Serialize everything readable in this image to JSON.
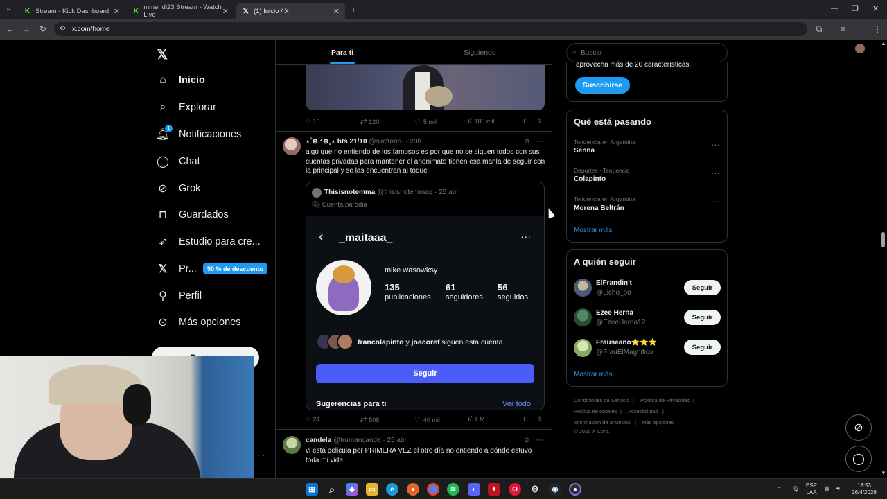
{
  "browser": {
    "tabs": [
      {
        "label": "Stream - Kick Dashboard",
        "favicon": "kick-icon"
      },
      {
        "label": "mmendi23 Stream - Watch Live",
        "favicon": "kick-icon"
      },
      {
        "label": "(1) Inicio / X",
        "favicon": "x-icon",
        "active": true
      }
    ],
    "url": "x.com/home"
  },
  "nav": {
    "logo": "X",
    "items": [
      {
        "label": "Inicio",
        "icon": "home-icon"
      },
      {
        "label": "Explorar",
        "icon": "search-icon"
      },
      {
        "label": "Notificaciones",
        "icon": "bell-icon",
        "badge": "1"
      },
      {
        "label": "Chat",
        "icon": "chat-icon"
      },
      {
        "label": "Grok",
        "icon": "grok-icon"
      },
      {
        "label": "Guardados",
        "icon": "bookmark-icon"
      },
      {
        "label": "Estudio para cre...",
        "icon": "rocket-icon"
      },
      {
        "label": "Pr...",
        "icon": "x-premium-icon"
      },
      {
        "label": "Perfil",
        "icon": "person-icon"
      },
      {
        "label": "Más opciones",
        "icon": "more-circle-icon"
      }
    ],
    "premium_badge": "50 % de descuento",
    "post_button": "Postear",
    "more_dots": "···"
  },
  "feed": {
    "tabs": {
      "for_you": "Para ti",
      "following": "Siguiendo"
    },
    "post1_actions": {
      "replies": "16",
      "reposts": "120",
      "likes": "5 mil",
      "views": "185 mil"
    },
    "post2": {
      "name": "⋆˚⊛.ᐟ⊛˳⋆ bts 21/10",
      "handle": "@swlftooru · 20h",
      "text": "algo que no entiendo de los famosos es por que no se siguen todos con sus cuentas privadas para mantener el anonimato tienen esa manla de seguir con la principal y se las encuentran al toque",
      "quote": {
        "name": "Thisisnotemma",
        "handle": "@thisisnotemmag · 25 abr.",
        "label": "Cuenta parodia",
        "profile": {
          "username": "_maitaaa_",
          "display_name": "mike wasowksy",
          "stats": [
            {
              "value": "135",
              "label": "publicaciones"
            },
            {
              "value": "61",
              "label": "seguidores"
            },
            {
              "value": "56",
              "label": "seguidos"
            }
          ],
          "followed_by_a": "francolapinto",
          "followed_by_y": "y",
          "followed_by_b": "joacoref",
          "followed_by_suffix": "siguen esta cuenta",
          "follow_button": "Seguir",
          "suggestions": "Sugerencias para ti",
          "see_all": "Ver todo"
        }
      },
      "actions": {
        "replies": "24",
        "reposts": "508",
        "likes": "40 mil",
        "views": "1 M"
      }
    },
    "post3": {
      "name": "candela",
      "handle": "@trumancande · 25 abr.",
      "text": "vi esta pelicula por PRIMERA VEZ el otro día no entiendo a dónde estuvo toda mi vida"
    }
  },
  "sidebar": {
    "search_placeholder": "Buscar",
    "premium_text": "aprovecha más de 20 características.",
    "subscribe": "Suscribirse",
    "trends_title": "Qué está pasando",
    "trends": [
      {
        "meta": "Tendencia en Argentina",
        "name": "Senna"
      },
      {
        "meta": "Deportes · Tendencia",
        "name": "Colapinto"
      },
      {
        "meta": "Tendencia en Argentina",
        "name": "Morena Beltrán"
      }
    ],
    "show_more": "Mostrar más",
    "who_title": "A quién seguir",
    "who": [
      {
        "name": "ElFrandin't",
        "handle": "@Licho_oo",
        "button": "Seguir"
      },
      {
        "name": "Ezee Herna",
        "handle": "@EzeeHerna12",
        "button": "Seguir"
      },
      {
        "name": "Frauseano⭐⭐⭐",
        "handle": "@FrauElMagnifico",
        "button": "Seguir"
      }
    ],
    "footer": [
      "Condiciones de Servicio",
      "Política de Privacidad",
      "Política de cookies",
      "Accesibilidad",
      "Información de anuncios",
      "Más opciones ···",
      "© 2026 X Corp."
    ]
  },
  "taskbar": {
    "lang_top": "ESP",
    "lang_bottom": "LAA",
    "time": "18:53",
    "date": "26/4/2026"
  }
}
